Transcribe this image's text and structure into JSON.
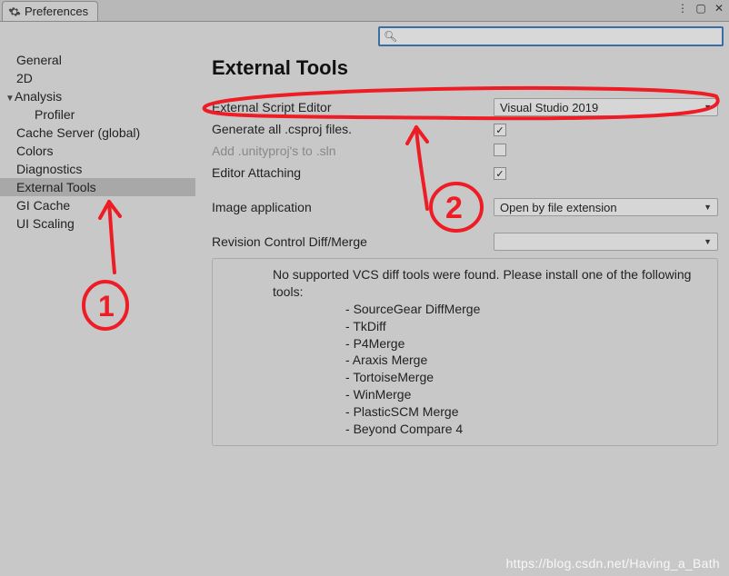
{
  "tab": {
    "title": "Preferences"
  },
  "search": {
    "placeholder": ""
  },
  "sidebar": {
    "items": [
      {
        "label": "General"
      },
      {
        "label": "2D"
      },
      {
        "label": "Analysis"
      },
      {
        "label": "Profiler"
      },
      {
        "label": "Cache Server (global)"
      },
      {
        "label": "Colors"
      },
      {
        "label": "Diagnostics"
      },
      {
        "label": "External Tools"
      },
      {
        "label": "GI Cache"
      },
      {
        "label": "UI Scaling"
      }
    ]
  },
  "main": {
    "heading": "External Tools",
    "ext_editor_label": "External Script Editor",
    "ext_editor_value": "Visual Studio 2019",
    "gen_csproj_label": "Generate all .csproj files.",
    "gen_csproj_checked": "✓",
    "add_unityproj_label": "Add .unityproj's to .sln",
    "editor_attach_label": "Editor Attaching",
    "editor_attach_checked": "✓",
    "image_app_label": "Image application",
    "image_app_value": "Open by file extension",
    "rev_ctrl_label": "Revision Control Diff/Merge",
    "rev_ctrl_value": "",
    "info_msg": "No supported VCS diff tools were found. Please install one of the following tools:",
    "tools": [
      "SourceGear DiffMerge",
      "TkDiff",
      "P4Merge",
      "Araxis Merge",
      "TortoiseMerge",
      "WinMerge",
      "PlasticSCM Merge",
      "Beyond Compare 4"
    ]
  },
  "watermark": "https://blog.csdn.net/Having_a_Bath",
  "annotations": {
    "mark1": "1",
    "mark2": "2"
  }
}
